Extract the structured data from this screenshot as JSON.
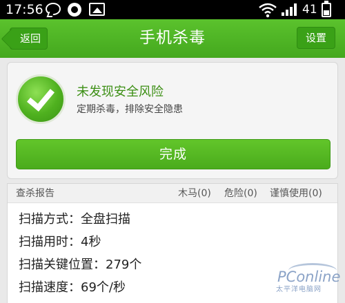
{
  "status_bar": {
    "time": "17:56",
    "battery": "41",
    "icons": [
      "chat-bubble-icon",
      "sync-icon",
      "image-icon",
      "wifi-icon",
      "signal-icon",
      "battery-icon"
    ]
  },
  "header": {
    "title": "手机杀毒",
    "back_label": "返回",
    "settings_label": "设置"
  },
  "result": {
    "title": "未发现安全风险",
    "subtitle": "定期杀毒，排除安全隐患",
    "done_label": "完成"
  },
  "report": {
    "title": "查杀报告",
    "trojan": "木马(0)",
    "danger": "危险(0)",
    "caution": "谨慎使用(0)",
    "rows": [
      "扫描方式：全盘扫描",
      "扫描用时：4秒",
      "扫描关键位置：279个",
      "扫描速度：69个/秒"
    ]
  },
  "watermark": {
    "text": "PConline",
    "sub": "太平洋电脑网"
  },
  "colors": {
    "accent_green": "#4aab1c",
    "header_green": "#5bc22d",
    "success_text": "#3c8f14"
  }
}
